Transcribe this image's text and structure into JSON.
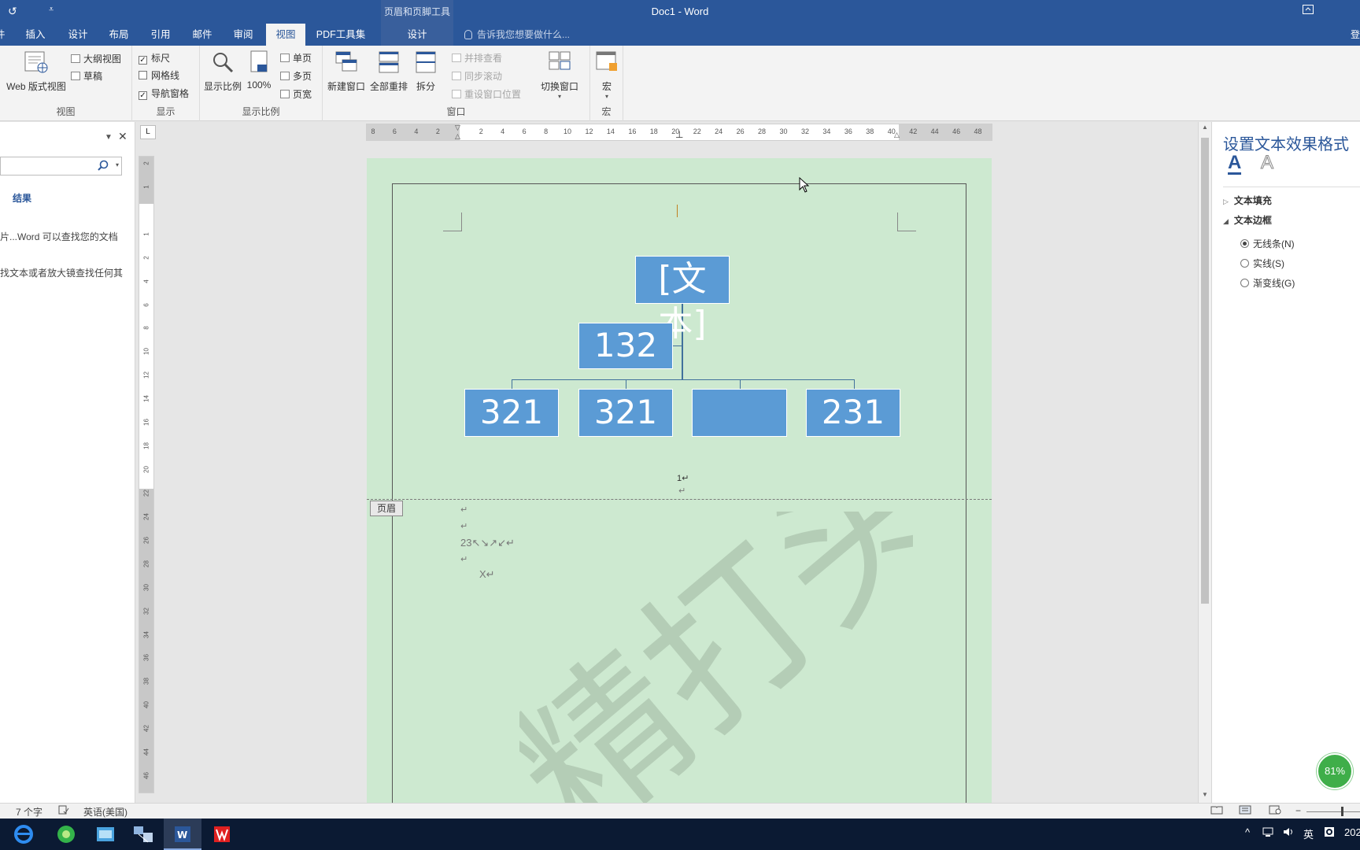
{
  "titlebar": {
    "title": "Doc1 - Word",
    "context_group": "页眉和页脚工具",
    "undo_glyph": "↺",
    "qat_more": "⩡"
  },
  "tabs": [
    "文件",
    "插入",
    "设计",
    "布局",
    "引用",
    "邮件",
    "审阅",
    "视图",
    "PDF工具集",
    "设计"
  ],
  "active_tab": "视图",
  "tellme_placeholder": "告诉我您想要做什么...",
  "signin": "登",
  "ribbon": {
    "views_group": {
      "label": "视图",
      "web_layout": "Web 版式视图",
      "outline": "大纲视图",
      "draft": "草稿"
    },
    "show_group": {
      "label": "显示",
      "ruler": "标尺",
      "ruler_checked": true,
      "gridlines": "网格线",
      "gridlines_checked": false,
      "nav_pane": "导航窗格",
      "nav_pane_checked": true
    },
    "zoom_group": {
      "label": "显示比例",
      "zoom": "显示比例",
      "pct100": "100%",
      "one_page": "单页",
      "multi_page": "多页",
      "page_width": "页宽"
    },
    "window_group": {
      "label": "窗口",
      "new_window": "新建窗口",
      "arrange_all": "全部重排",
      "split": "拆分",
      "side_by_side": "并排查看",
      "sync_scroll": "同步滚动",
      "reset_pos": "重设窗口位置",
      "switch_windows": "切换窗口"
    },
    "macros_group": {
      "label": "宏",
      "macros": "宏"
    }
  },
  "navpane": {
    "results_tab": "结果",
    "hint1": "片...Word 可以查找您的文档",
    "hint2": "找文本或者放大镜查找任何其"
  },
  "ruler": {
    "corner": "L",
    "ticks": [
      "8",
      "6",
      "4",
      "2",
      "",
      "2",
      "4",
      "6",
      "8",
      "10",
      "12",
      "14",
      "16",
      "18",
      "20",
      "22",
      "24",
      "26",
      "28",
      "30",
      "32",
      "34",
      "36",
      "38",
      "40",
      "42",
      "44",
      "46",
      "48"
    ]
  },
  "vruler_ticks": [
    "2",
    "1",
    "",
    "1",
    "2",
    "4",
    "6",
    "8",
    "10",
    "12",
    "14",
    "16",
    "18",
    "20",
    "22",
    "24",
    "26",
    "28",
    "30",
    "32",
    "34",
    "36",
    "38",
    "40",
    "42",
    "44",
    "46"
  ],
  "document": {
    "smartart": {
      "top": "[文本]",
      "assistant": "132",
      "children": [
        "321",
        "321",
        "",
        "231"
      ]
    },
    "page_num_mark": "1↵",
    "return_mark": "↵",
    "header_tag": "页眉",
    "line_23": "23↖↘↗↙↵",
    "line_x": "X↵",
    "watermark": "精打头"
  },
  "format_pane": {
    "title": "设置文本效果格式",
    "section_fill": "文本填充",
    "section_outline": "文本边框",
    "opt_none": "无线条(N)",
    "opt_solid": "实线(S)",
    "opt_gradient": "渐变线(G)",
    "selected": "无线条(N)"
  },
  "zoom_badge": "81%",
  "statusbar": {
    "word_count": "7 个字",
    "language": "英语(美国)"
  },
  "taskbar": {
    "tray_lang": "英",
    "clock": "202"
  },
  "colors": {
    "accent": "#2b579a",
    "page": "#cde9d0",
    "smartart": "#5b9bd5",
    "connector": "#41719c"
  }
}
